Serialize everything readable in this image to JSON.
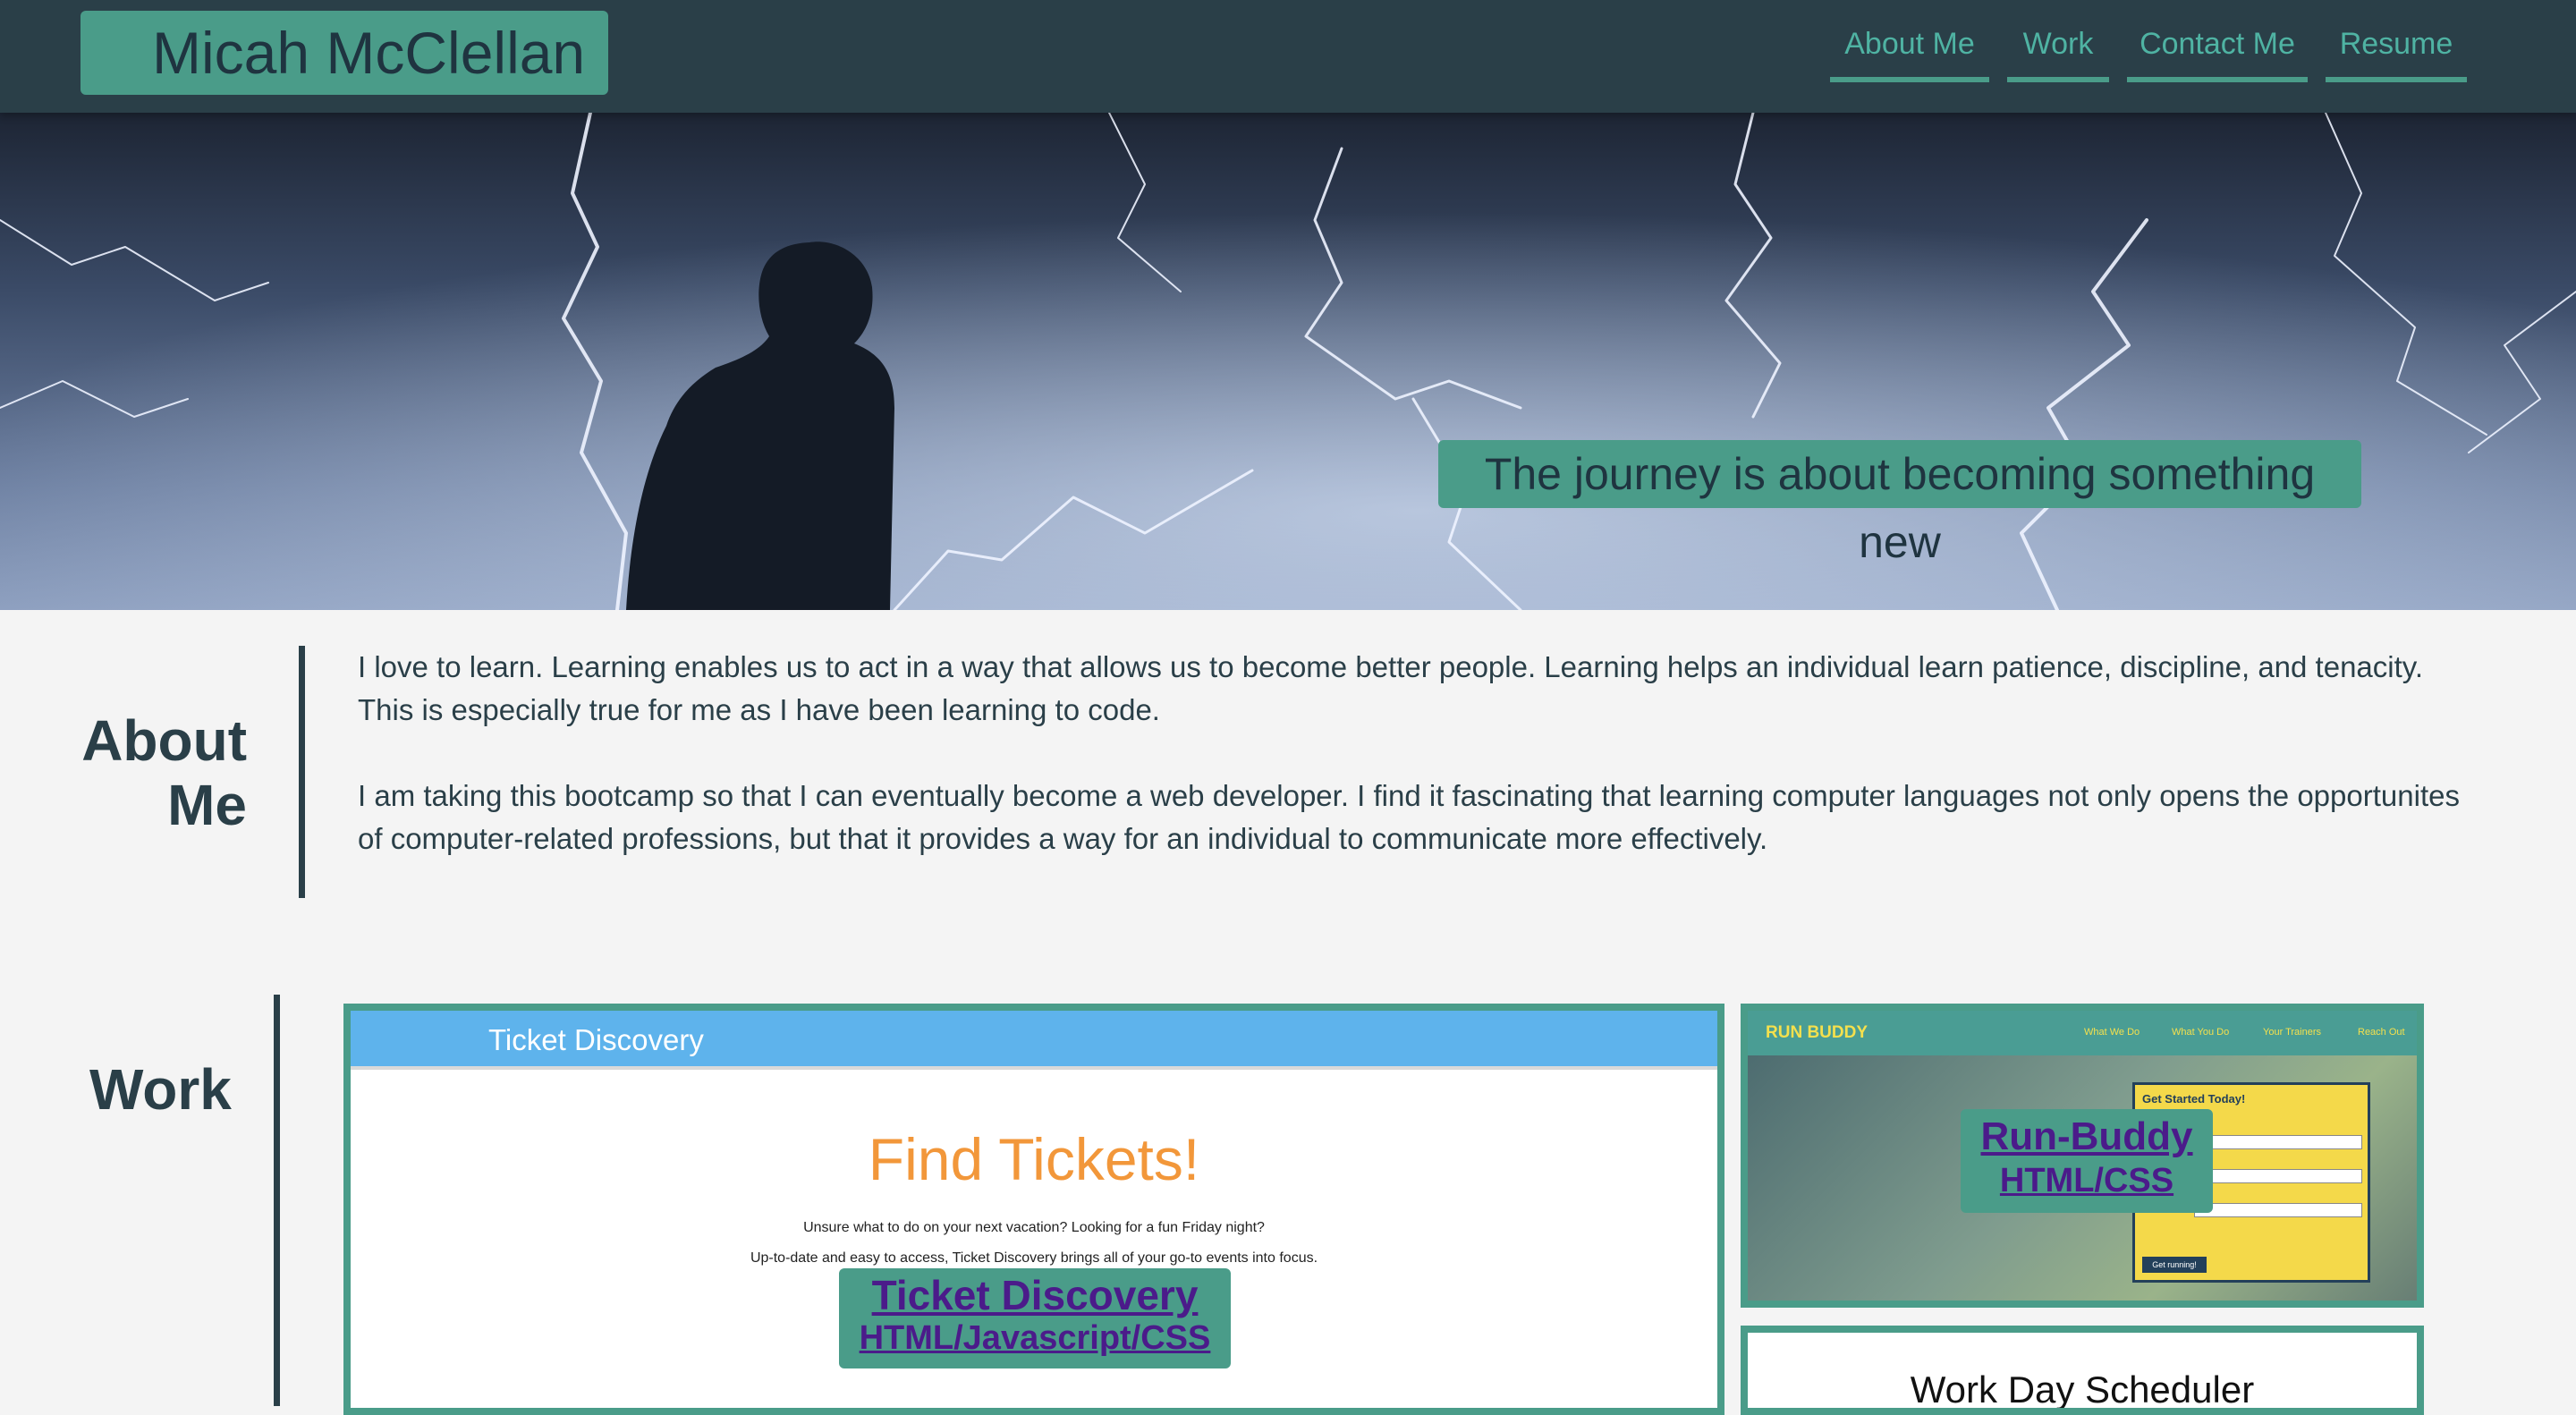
{
  "header": {
    "brand": "Micah McClellan",
    "nav": [
      {
        "label": "About Me"
      },
      {
        "label": "Work"
      },
      {
        "label": "Contact Me"
      },
      {
        "label": "Resume"
      }
    ]
  },
  "hero": {
    "tagline": "The journey is about becoming something new"
  },
  "about": {
    "heading_line1": "About",
    "heading_line2": "Me",
    "paragraphs": [
      "I love to learn. Learning enables us to act in a way that allows us to become better people. Learning helps an individual learn patience, discipline, and tenacity. This is especially true for me as I have been learning to code.",
      "I am taking this bootcamp so that I can eventually become a web developer. I find it fascinating that learning computer languages not only opens the opportunites of computer-related professions, but that it provides a way for an individual to communicate more effectively."
    ]
  },
  "work": {
    "heading": "Work",
    "ticket_discovery": {
      "screenshot_header": "Ticket Discovery",
      "screenshot_title": "Find Tickets!",
      "screenshot_line1": "Unsure what to do on your next vacation? Looking for a fun Friday night?",
      "screenshot_line2": "Up-to-date and easy to access, Ticket Discovery brings all of your go-to events into focus.",
      "link_title": "Ticket Discovery",
      "link_tech": "HTML/Javascript/CSS"
    },
    "run_buddy": {
      "screenshot_logo": "RUN BUDDY",
      "screenshot_nav": [
        "What We Do",
        "What You Do",
        "Your Trainers",
        "Reach Out"
      ],
      "screenshot_form_title": "Get Started Today!",
      "screenshot_button": "Get running!",
      "link_title": "Run-Buddy",
      "link_tech": "HTML/CSS"
    },
    "scheduler": {
      "screenshot_title": "Work Day Scheduler"
    }
  },
  "colors": {
    "header_bg": "#2a3f48",
    "accent": "#4a9c89",
    "nav_text": "#4fb3a3",
    "body_text": "#2a3f48",
    "link_text": "#4b1b8a"
  }
}
